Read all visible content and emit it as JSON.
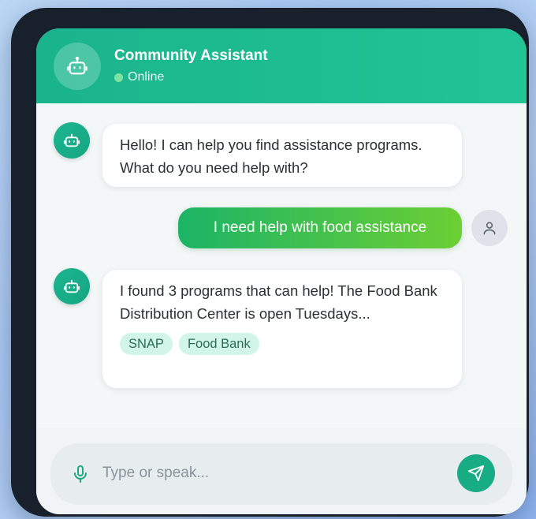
{
  "header": {
    "title": "Community Assistant",
    "status": "Online",
    "avatar_icon": "robot-icon"
  },
  "messages": [
    {
      "sender": "bot",
      "text": "Hello! I can help you find assistance programs. What do you need help with?"
    },
    {
      "sender": "user",
      "text": "I need help with food assistance"
    },
    {
      "sender": "bot",
      "text": "I found 3 programs that can help! The Food Bank Distribution Center is open Tuesdays...",
      "tags": [
        "SNAP",
        "Food Bank"
      ]
    }
  ],
  "input": {
    "placeholder": "Type or speak...",
    "mic_icon": "microphone-icon",
    "send_icon": "send-icon"
  },
  "colors": {
    "header": "#1ab48c",
    "user_bubble_start": "#1cb467",
    "user_bubble_end": "#6ccf34",
    "tag_bg": "#d2f5e9",
    "send_button": "#17ac84"
  }
}
